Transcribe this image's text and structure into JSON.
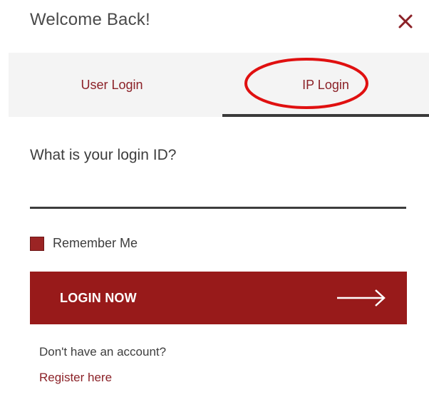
{
  "dialog": {
    "title": "Welcome Back!",
    "close_icon": "close-icon"
  },
  "tabs": [
    {
      "label": "User Login",
      "active": false
    },
    {
      "label": "IP Login",
      "active": true
    }
  ],
  "form": {
    "question": "What is your login ID?",
    "login_id_value": "",
    "remember_label": "Remember Me",
    "remember_checked": true,
    "submit_label": "LOGIN NOW",
    "submit_icon": "arrow-right-icon"
  },
  "footer": {
    "no_account_text": "Don't have an account?",
    "register_link": "Register here"
  },
  "colors": {
    "brand_red": "#981a1a",
    "link_red": "#8b2127",
    "annotation_red": "#e01010",
    "tab_background": "#f4f4f4"
  }
}
